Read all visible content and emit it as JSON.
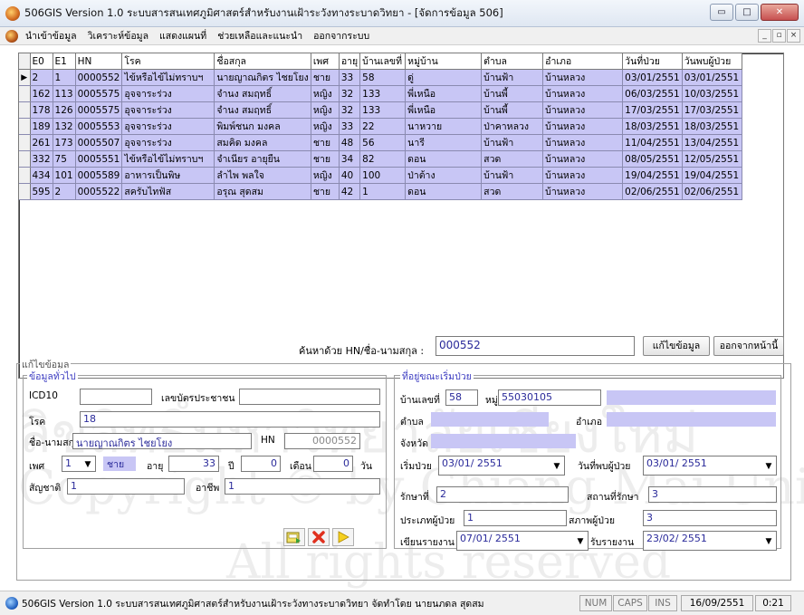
{
  "window": {
    "title": "506GIS Version 1.0  ระบบสารสนเทศภูมิศาสตร์สำหรับงานเฝ้าระวังทางระบาดวิทยา - [จัดการข้อมูล 506]",
    "buttons": [
      "▭",
      "□",
      "✕"
    ]
  },
  "menu": {
    "items": [
      "นำเข้าข้อมูล",
      "วิเคราะห์ข้อมูล",
      "แสดงแผนที่",
      "ช่วยเหลือและแนะนำ",
      "ออกจากระบบ"
    ],
    "mdi_buttons": [
      "_",
      "▫",
      "×"
    ]
  },
  "grid": {
    "columns": [
      "E0",
      "E1",
      "HN",
      "โรค",
      "ชื่อสกุล",
      "เพศ",
      "อายุ",
      "บ้านเลขที่",
      "หมู่บ้าน",
      "ตำบล",
      "อำเภอ",
      "วันที่ป่วย",
      "วันพบผู้ป่วย"
    ],
    "selected_marker": "▶",
    "rows": [
      [
        "2",
        "1",
        "0000552",
        "ไข้หรือไข้ไม่ทราบฯ",
        "นายญาณกิตร ไชยโยง",
        "ชาย",
        "33",
        "58",
        "ดู่",
        "บ้านฟ้า",
        "บ้านหลวง",
        "03/01/2551",
        "03/01/2551"
      ],
      [
        "162",
        "113",
        "0005575",
        "อุจจาระร่วง",
        "จำนง สมฤทธิ์",
        "หญิง",
        "32",
        "133",
        "พี่เหนือ",
        "บ้านพี้",
        "บ้านหลวง",
        "06/03/2551",
        "10/03/2551"
      ],
      [
        "178",
        "126",
        "0005575",
        "อุจจาระร่วง",
        "จำนง สมฤทธิ์",
        "หญิง",
        "32",
        "133",
        "พี่เหนือ",
        "บ้านพี้",
        "บ้านหลวง",
        "17/03/2551",
        "17/03/2551"
      ],
      [
        "189",
        "132",
        "0005553",
        "อุจจาระร่วง",
        "พิมพ์ชนก มงคล",
        "หญิง",
        "33",
        "22",
        "นาหวาย",
        "ป่าคาหลวง",
        "บ้านหลวง",
        "18/03/2551",
        "18/03/2551"
      ],
      [
        "261",
        "173",
        "0005507",
        "อุจจาระร่วง",
        "สมคิด มงคล",
        "ชาย",
        "48",
        "56",
        "นารี",
        "บ้านฟ้า",
        "บ้านหลวง",
        "11/04/2551",
        "13/04/2551"
      ],
      [
        "332",
        "75",
        "0005551",
        "ไข้หรือไข้ไม่ทราบฯ",
        "จำเนียร อายุยืน",
        "ชาย",
        "34",
        "82",
        "ดอน",
        "สวด",
        "บ้านหลวง",
        "08/05/2551",
        "12/05/2551"
      ],
      [
        "434",
        "101",
        "0005589",
        "อาหารเป็นพิษ",
        "ลำไพ พลใจ",
        "หญิง",
        "40",
        "100",
        "ป่าต้าง",
        "บ้านฟ้า",
        "บ้านหลวง",
        "19/04/2551",
        "19/04/2551"
      ],
      [
        "595",
        "2",
        "0005522",
        "สครับไทฟัส",
        "อรุณ สุดสม",
        "ชาย",
        "42",
        "1",
        "ดอน",
        "สวด",
        "บ้านหลวง",
        "02/06/2551",
        "02/06/2551"
      ]
    ]
  },
  "search": {
    "label": "ค้นหาด้วย HN/ชื่อ-นามสกุล :",
    "value": "000552",
    "edit_button": "แก้ไขข้อมูล",
    "exit_button": "ออกจากหน้านี้"
  },
  "edit": {
    "frame_title": "แก้ไขข้อมูล",
    "general": {
      "title": "ข้อมูลทั่วไป",
      "icd10_label": "ICD10",
      "icd10_value": "",
      "id_card_label": "เลขบัตรประชาชน",
      "id_card_value": "",
      "disease_label": "โรค",
      "disease_value": "18",
      "name_label": "ชื่อ-นามสกุล",
      "name_value": "นายญาณกิตร ไชยโยง",
      "hn_label": "HN",
      "hn_value": "0000552",
      "sex_label": "เพศ",
      "sex_value": "1",
      "sex_text": "ชาย",
      "age_label": "อายุ",
      "age_years": "33",
      "year_unit": "ปี",
      "age_months": "0",
      "month_unit": "เดือน",
      "age_days": "0",
      "day_unit": "วัน",
      "nationality_label": "สัญชาติ",
      "nationality_value": "1",
      "occupation_label": "อาชีพ",
      "occupation_value": "1"
    },
    "address": {
      "title": "ที่อยู่ขณะเริ่มป่วย",
      "house_no_label": "บ้านเลขที่",
      "house_no_value": "58",
      "moo_label": "หมู่",
      "moo_value": "55030105",
      "tambon_label": "ตำบล",
      "amphoe_label": "อำเภอ",
      "province_label": "จังหวัด",
      "onset_label": "เริ่มป่วย",
      "onset_value": "03/01/ 2551",
      "found_label": "วันที่พบผู้ป่วย",
      "found_value": "03/01/ 2551",
      "treat_label": "รักษาที่",
      "treat_value": "2",
      "place_label": "สถานที่รักษา",
      "place_value": "3",
      "ptype_label": "ประเภทผู้ป่วย",
      "ptype_value": "1",
      "pstatus_label": "สภาพผู้ป่วย",
      "pstatus_value": "3",
      "write_label": "เขียนรายงาน",
      "write_value": "07/01/ 2551",
      "recv_label": "รับรายงาน",
      "recv_value": "23/02/ 2551"
    }
  },
  "watermark": {
    "line1": "MAI UNIVERS",
    "line2": "ลิขสิทธิ์มหาวิทยาลัยเชียงใหม่",
    "line3": "Copyright © by Chiang Mai University",
    "line4": "All rights reserved"
  },
  "status": {
    "text": "506GIS Version 1.0 ระบบสารสนเทศภูมิศาสตร์สำหรับงานเฝ้าระวังทางระบาดวิทยา จัดทำโดย นายนภดล สุดสม",
    "num": "NUM",
    "caps": "CAPS",
    "ins": "INS",
    "date": "16/09/2551",
    "time": "0:21"
  },
  "colors": {
    "row_fill": "#c8c6f5",
    "section_title": "#3a3ac0"
  }
}
